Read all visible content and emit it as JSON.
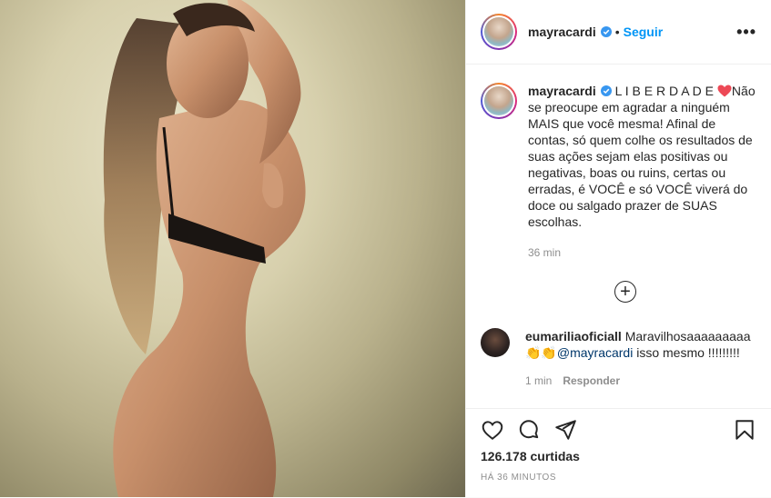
{
  "header": {
    "username": "mayracardi",
    "separator": "•",
    "follow_label": "Seguir",
    "more_label": "•••"
  },
  "caption": {
    "username": "mayracardi",
    "text_before_heart": " L I B E R D A D E ",
    "text_after_heart": "Não se preocupe em agradar a ninguém MAIS que você mesma! Afinal de contas, só quem colhe os resultados de suas ações sejam elas positivas ou negativas, boas ou ruins, certas ou erradas, é VOCÊ e só VOCÊ viverá do doce ou salgado prazer de SUAS escolhas.",
    "time": "36 min"
  },
  "load_more_label": "+",
  "comment": {
    "username": "eumariliaoficiall",
    "text_start": " Maravilhosaaaaaaaaa ",
    "emoji": "👏👏",
    "mention": "@mayracardi",
    "text_end": " isso mesmo !!!!!!!!!",
    "time": "1 min",
    "reply_label": "Responder"
  },
  "stats": {
    "likes": "126.178 curtidas",
    "posted_ago": "HÁ 36 MINUTOS"
  },
  "colors": {
    "accent": "#0095f6",
    "verified": "#3897f0",
    "heart": "#ed4956",
    "muted": "#8e8e8e",
    "text": "#262626"
  }
}
